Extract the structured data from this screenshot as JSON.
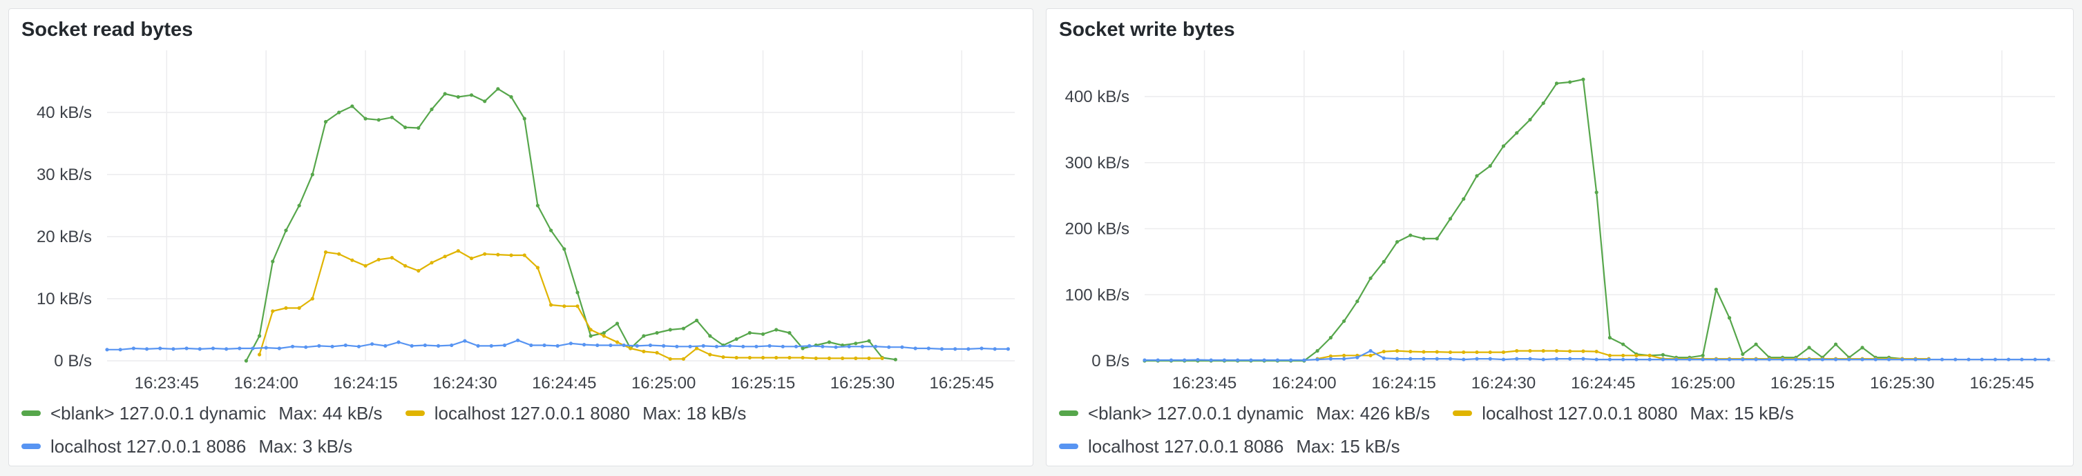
{
  "panels": [
    {
      "id": "read",
      "title": "Socket read bytes",
      "legend": [
        {
          "name": "<blank> 127.0.0.1 dynamic",
          "max_label": "Max:",
          "max": "44 kB/s",
          "color": "#56a64b"
        },
        {
          "name": "localhost 127.0.0.1 8080",
          "max_label": "Max:",
          "max": "18 kB/s",
          "color": "#e0b400"
        },
        {
          "name": "localhost 127.0.0.1 8086",
          "max_label": "Max:",
          "max": "3 kB/s",
          "color": "#5794f2"
        }
      ]
    },
    {
      "id": "write",
      "title": "Socket write bytes",
      "legend": [
        {
          "name": "<blank> 127.0.0.1 dynamic",
          "max_label": "Max:",
          "max": "426 kB/s",
          "color": "#56a64b"
        },
        {
          "name": "localhost 127.0.0.1 8080",
          "max_label": "Max:",
          "max": "15 kB/s",
          "color": "#e0b400"
        },
        {
          "name": "localhost 127.0.0.1 8086",
          "max_label": "Max:",
          "max": "15 kB/s",
          "color": "#5794f2"
        }
      ]
    }
  ],
  "chart_data": [
    {
      "type": "line",
      "title": "Socket read bytes",
      "x_ticks": [
        "16:23:45",
        "16:24:00",
        "16:24:15",
        "16:24:30",
        "16:24:45",
        "16:25:00",
        "16:25:15",
        "16:25:30",
        "16:25:45"
      ],
      "y_ticks": [
        "0 B/s",
        "10 kB/s",
        "20 kB/s",
        "30 kB/s",
        "40 kB/s"
      ],
      "ylim": [
        0,
        50
      ],
      "xlim": [
        "16:23:36",
        "16:25:53"
      ],
      "grid": true,
      "legend_position": "bottom",
      "series": [
        {
          "name": "<blank> 127.0.0.1 dynamic",
          "color": "#56a64b",
          "x": [
            "16:23:57",
            "16:23:59",
            "16:24:01",
            "16:24:03",
            "16:24:05",
            "16:24:07",
            "16:24:09",
            "16:24:11",
            "16:24:13",
            "16:24:15",
            "16:24:17",
            "16:24:19",
            "16:24:21",
            "16:24:23",
            "16:24:25",
            "16:24:27",
            "16:24:29",
            "16:24:31",
            "16:24:33",
            "16:24:35",
            "16:24:37",
            "16:24:39",
            "16:24:41",
            "16:24:43",
            "16:24:45",
            "16:24:47",
            "16:24:49",
            "16:24:51",
            "16:24:53",
            "16:24:55",
            "16:24:57",
            "16:24:59",
            "16:25:01",
            "16:25:03",
            "16:25:05",
            "16:25:07",
            "16:25:09",
            "16:25:11",
            "16:25:13",
            "16:25:15",
            "16:25:17",
            "16:25:19",
            "16:25:21",
            "16:25:23",
            "16:25:25",
            "16:25:27",
            "16:25:29",
            "16:25:31",
            "16:25:33",
            "16:25:35"
          ],
          "y": [
            0,
            4,
            16,
            21,
            25,
            30,
            38.5,
            40,
            41,
            39,
            38.8,
            39.2,
            37.6,
            37.5,
            40.5,
            43,
            42.5,
            42.8,
            41.8,
            43.8,
            42.5,
            39,
            25,
            21,
            18,
            11,
            4,
            4.5,
            6,
            2,
            4,
            4.5,
            5,
            5.2,
            6.5,
            4,
            2.5,
            3.5,
            4.5,
            4.3,
            5,
            4.5,
            2,
            2.5,
            3,
            2.5,
            2.8,
            3.2,
            0.5,
            0.2
          ]
        },
        {
          "name": "localhost 127.0.0.1 8080",
          "color": "#e0b400",
          "x": [
            "16:23:59",
            "16:24:01",
            "16:24:03",
            "16:24:05",
            "16:24:07",
            "16:24:09",
            "16:24:11",
            "16:24:13",
            "16:24:15",
            "16:24:17",
            "16:24:19",
            "16:24:21",
            "16:24:23",
            "16:24:25",
            "16:24:27",
            "16:24:29",
            "16:24:31",
            "16:24:33",
            "16:24:35",
            "16:24:37",
            "16:24:39",
            "16:24:41",
            "16:24:43",
            "16:24:45",
            "16:24:47",
            "16:24:49",
            "16:24:51",
            "16:24:53",
            "16:24:55",
            "16:24:57",
            "16:24:59",
            "16:25:01",
            "16:25:03",
            "16:25:05",
            "16:25:07",
            "16:25:09",
            "16:25:11",
            "16:25:13",
            "16:25:15",
            "16:25:17",
            "16:25:19",
            "16:25:21",
            "16:25:23",
            "16:25:25",
            "16:25:27",
            "16:25:29",
            "16:25:31",
            "16:25:33"
          ],
          "y": [
            1,
            8,
            8.5,
            8.5,
            10,
            17.5,
            17.2,
            16.2,
            15.3,
            16.3,
            16.6,
            15.3,
            14.5,
            15.8,
            16.8,
            17.7,
            16.5,
            17.2,
            17.1,
            17,
            17,
            15,
            9,
            8.8,
            8.8,
            5,
            4,
            3,
            2,
            1.5,
            1.3,
            0.3,
            0.3,
            2,
            1,
            0.6,
            0.5,
            0.5,
            0.5,
            0.5,
            0.5,
            0.5,
            0.4,
            0.4,
            0.4,
            0.4,
            0.4,
            0.4
          ]
        },
        {
          "name": "localhost 127.0.0.1 8086",
          "color": "#5794f2",
          "x": [
            "16:23:36",
            "16:23:38",
            "16:23:40",
            "16:23:42",
            "16:23:44",
            "16:23:46",
            "16:23:48",
            "16:23:50",
            "16:23:52",
            "16:23:54",
            "16:23:56",
            "16:23:58",
            "16:24:00",
            "16:24:02",
            "16:24:04",
            "16:24:06",
            "16:24:08",
            "16:24:10",
            "16:24:12",
            "16:24:14",
            "16:24:16",
            "16:24:18",
            "16:24:20",
            "16:24:22",
            "16:24:24",
            "16:24:26",
            "16:24:28",
            "16:24:30",
            "16:24:32",
            "16:24:34",
            "16:24:36",
            "16:24:38",
            "16:24:40",
            "16:24:42",
            "16:24:44",
            "16:24:46",
            "16:24:48",
            "16:24:50",
            "16:24:52",
            "16:24:54",
            "16:24:56",
            "16:24:58",
            "16:25:00",
            "16:25:02",
            "16:25:04",
            "16:25:06",
            "16:25:08",
            "16:25:10",
            "16:25:12",
            "16:25:14",
            "16:25:16",
            "16:25:18",
            "16:25:20",
            "16:25:22",
            "16:25:24",
            "16:25:26",
            "16:25:28",
            "16:25:30",
            "16:25:32",
            "16:25:34",
            "16:25:36",
            "16:25:38",
            "16:25:40",
            "16:25:42",
            "16:25:44",
            "16:25:46",
            "16:25:48",
            "16:25:50",
            "16:25:52"
          ],
          "y": [
            1.8,
            1.8,
            2,
            1.9,
            2,
            1.9,
            2,
            1.9,
            2,
            1.9,
            2,
            2,
            2.1,
            2,
            2.3,
            2.2,
            2.4,
            2.3,
            2.5,
            2.3,
            2.7,
            2.4,
            3,
            2.4,
            2.5,
            2.4,
            2.5,
            3.2,
            2.4,
            2.4,
            2.5,
            3.3,
            2.5,
            2.5,
            2.4,
            2.8,
            2.6,
            2.5,
            2.5,
            2.5,
            2.4,
            2.5,
            2.4,
            2.3,
            2.3,
            2.4,
            2.3,
            2.4,
            2.3,
            2.3,
            2.4,
            2.3,
            2.3,
            2.4,
            2.3,
            2.2,
            2.3,
            2.3,
            2.3,
            2.2,
            2.2,
            2,
            2,
            1.9,
            1.9,
            1.9,
            2,
            1.9,
            1.9
          ]
        }
      ]
    },
    {
      "type": "line",
      "title": "Socket write bytes",
      "x_ticks": [
        "16:23:45",
        "16:24:00",
        "16:24:15",
        "16:24:30",
        "16:24:45",
        "16:25:00",
        "16:25:15",
        "16:25:30",
        "16:25:45"
      ],
      "y_ticks": [
        "0 B/s",
        "100 kB/s",
        "200 kB/s",
        "300 kB/s",
        "400 kB/s"
      ],
      "ylim": [
        0,
        470
      ],
      "xlim": [
        "16:23:36",
        "16:25:53"
      ],
      "grid": true,
      "legend_position": "bottom",
      "series": [
        {
          "name": "<blank> 127.0.0.1 dynamic",
          "color": "#56a64b",
          "x": [
            "16:23:36",
            "16:23:38",
            "16:23:40",
            "16:23:42",
            "16:23:44",
            "16:23:46",
            "16:23:48",
            "16:23:50",
            "16:23:52",
            "16:23:54",
            "16:23:56",
            "16:23:58",
            "16:24:00",
            "16:24:02",
            "16:24:04",
            "16:24:06",
            "16:24:08",
            "16:24:10",
            "16:24:12",
            "16:24:14",
            "16:24:16",
            "16:24:18",
            "16:24:20",
            "16:24:22",
            "16:24:24",
            "16:24:26",
            "16:24:28",
            "16:24:30",
            "16:24:32",
            "16:24:34",
            "16:24:36",
            "16:24:38",
            "16:24:40",
            "16:24:42",
            "16:24:44",
            "16:24:46",
            "16:24:48",
            "16:24:50",
            "16:24:52",
            "16:24:54",
            "16:24:56",
            "16:24:58",
            "16:25:00",
            "16:25:02",
            "16:25:04",
            "16:25:06",
            "16:25:08",
            "16:25:10",
            "16:25:12",
            "16:25:14",
            "16:25:16",
            "16:25:18",
            "16:25:20",
            "16:25:22",
            "16:25:24",
            "16:25:26",
            "16:25:28",
            "16:25:30",
            "16:25:32"
          ],
          "y": [
            0,
            0,
            0,
            0,
            0,
            0,
            0,
            0,
            0,
            0,
            0,
            0,
            0,
            15,
            35,
            60,
            90,
            125,
            150,
            180,
            190,
            185,
            185,
            215,
            245,
            280,
            295,
            325,
            345,
            365,
            390,
            420,
            422,
            426,
            255,
            35,
            25,
            10,
            8,
            9,
            5,
            5,
            8,
            108,
            65,
            10,
            25,
            5,
            5,
            5,
            20,
            5,
            25,
            5,
            20,
            5,
            5,
            3,
            2
          ]
        },
        {
          "name": "localhost 127.0.0.1 8080",
          "color": "#e0b400",
          "x": [
            "16:24:02",
            "16:24:04",
            "16:24:06",
            "16:24:08",
            "16:24:10",
            "16:24:12",
            "16:24:14",
            "16:24:16",
            "16:24:18",
            "16:24:20",
            "16:24:22",
            "16:24:24",
            "16:24:26",
            "16:24:28",
            "16:24:30",
            "16:24:32",
            "16:24:34",
            "16:24:36",
            "16:24:38",
            "16:24:40",
            "16:24:42",
            "16:24:44",
            "16:24:46",
            "16:24:48",
            "16:24:50",
            "16:24:52",
            "16:24:54",
            "16:24:56",
            "16:24:58",
            "16:25:00",
            "16:25:02",
            "16:25:04",
            "16:25:06",
            "16:25:08",
            "16:25:10",
            "16:25:12",
            "16:25:14",
            "16:25:16",
            "16:25:18",
            "16:25:20",
            "16:25:22",
            "16:25:24",
            "16:25:26",
            "16:25:28",
            "16:25:30",
            "16:25:32",
            "16:25:34"
          ],
          "y": [
            3,
            7,
            8,
            8,
            8,
            14,
            15,
            14,
            13.5,
            13.5,
            13,
            13,
            13,
            13,
            13,
            15,
            15,
            15,
            15,
            14.5,
            14.5,
            14,
            8,
            8,
            8,
            8,
            3,
            3,
            3,
            3,
            3,
            3,
            3,
            3,
            3,
            3,
            3,
            3,
            3,
            3,
            3,
            3,
            3,
            3,
            3,
            3,
            3
          ]
        },
        {
          "name": "localhost 127.0.0.1 8086",
          "color": "#5794f2",
          "x": [
            "16:23:36",
            "16:23:38",
            "16:23:40",
            "16:23:42",
            "16:23:44",
            "16:23:46",
            "16:23:48",
            "16:23:50",
            "16:23:52",
            "16:23:54",
            "16:23:56",
            "16:23:58",
            "16:24:00",
            "16:24:02",
            "16:24:04",
            "16:24:06",
            "16:24:08",
            "16:24:10",
            "16:24:12",
            "16:24:14",
            "16:24:16",
            "16:24:18",
            "16:24:20",
            "16:24:22",
            "16:24:24",
            "16:24:26",
            "16:24:28",
            "16:24:30",
            "16:24:32",
            "16:24:34",
            "16:24:36",
            "16:24:38",
            "16:24:40",
            "16:24:42",
            "16:24:44",
            "16:24:46",
            "16:24:48",
            "16:24:50",
            "16:24:52",
            "16:24:54",
            "16:24:56",
            "16:24:58",
            "16:25:00",
            "16:25:02",
            "16:25:04",
            "16:25:06",
            "16:25:08",
            "16:25:10",
            "16:25:12",
            "16:25:14",
            "16:25:16",
            "16:25:18",
            "16:25:20",
            "16:25:22",
            "16:25:24",
            "16:25:26",
            "16:25:28",
            "16:25:30",
            "16:25:32",
            "16:25:34",
            "16:25:36",
            "16:25:38",
            "16:25:40",
            "16:25:42",
            "16:25:44",
            "16:25:46",
            "16:25:48",
            "16:25:50",
            "16:25:52"
          ],
          "y": [
            1,
            1,
            1,
            1,
            1.5,
            1,
            1,
            1,
            1,
            1,
            1,
            1,
            1,
            2,
            3,
            3,
            5,
            15,
            4,
            3,
            3,
            3,
            3,
            3,
            2,
            3,
            3,
            2,
            3,
            3,
            2,
            3,
            3,
            3,
            2,
            2,
            2,
            2,
            2,
            2,
            2,
            2,
            2,
            2,
            2,
            2,
            2,
            2,
            2,
            2,
            2,
            2,
            2,
            2,
            2,
            2,
            2,
            2,
            2,
            2,
            2,
            2,
            2,
            2,
            2,
            2,
            2,
            2,
            2
          ]
        }
      ]
    }
  ]
}
